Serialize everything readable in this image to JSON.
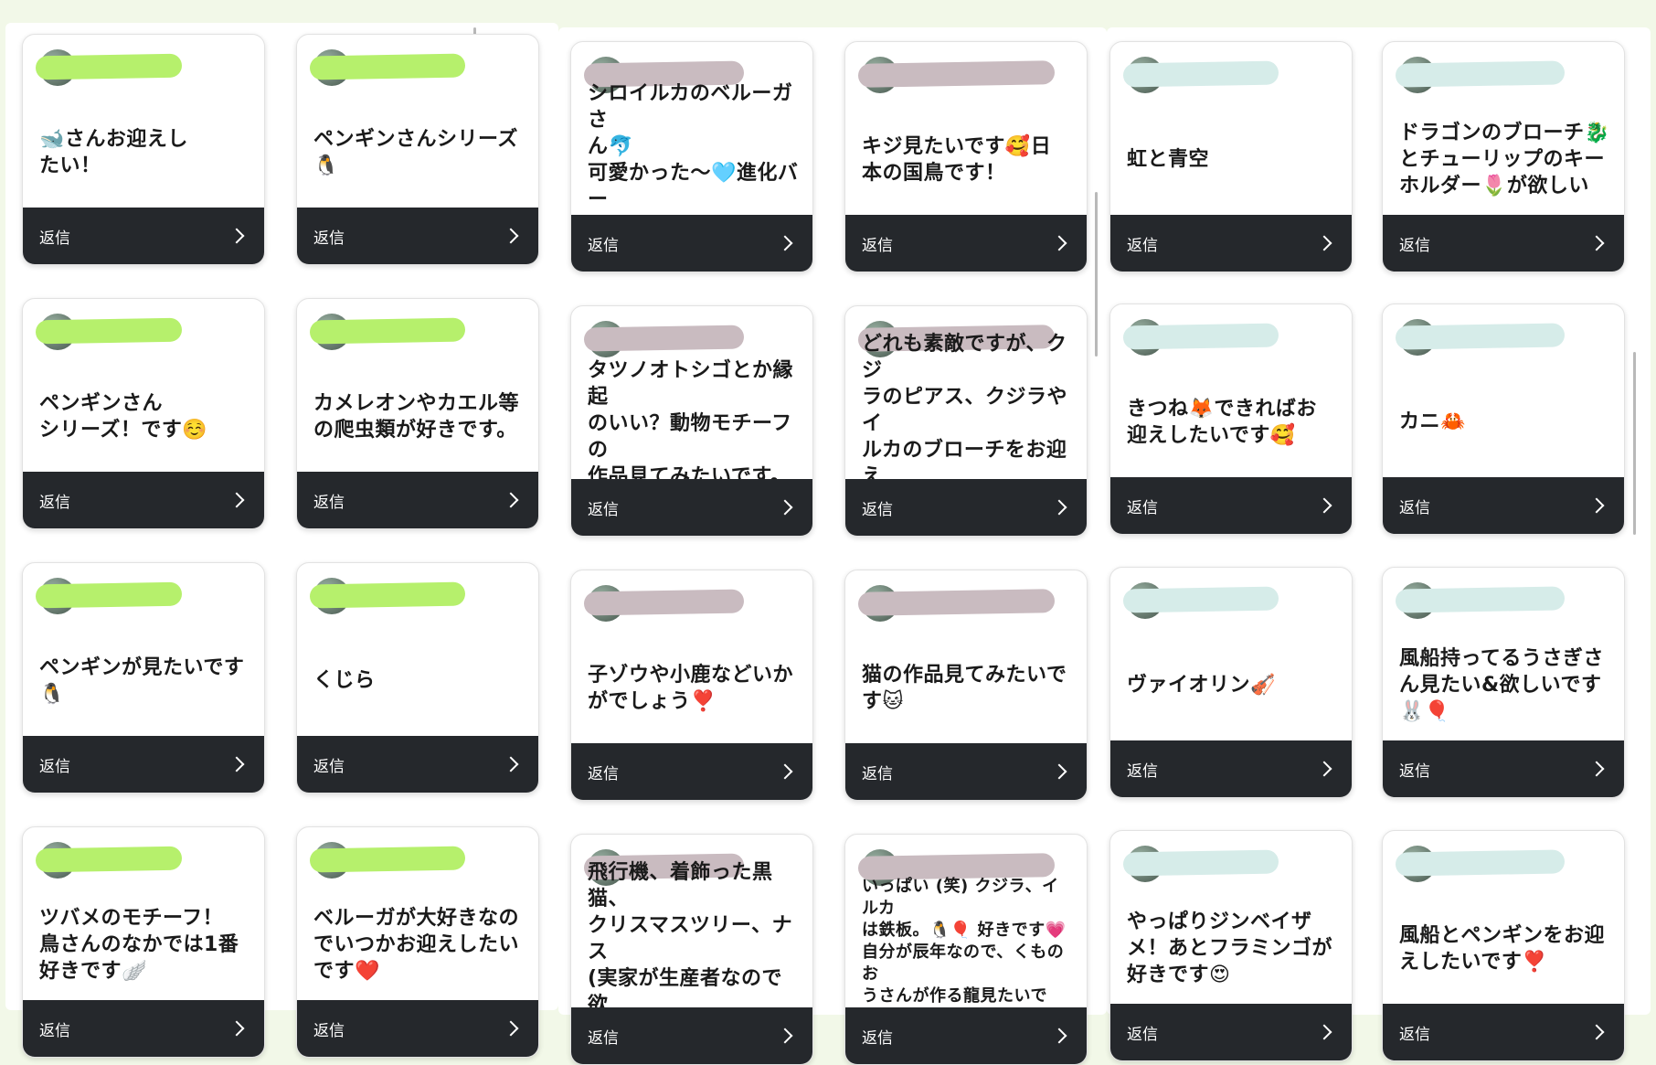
{
  "colors": {
    "reply_bar": "#25282c",
    "green_scribble": "#b6f06c",
    "mauve_scribble": "#c9bbc0",
    "aqua_scribble": "#d6ece9"
  },
  "reply_label": "返信",
  "cards": [
    {
      "message": "🐋さんお迎えし\nたい！"
    },
    {
      "message": "ペンギンさんシリーズ\n🐧"
    },
    {
      "message": "シロイルカのベルーガさ\nん🐬\n可愛かった〜🩵進化バー\nジョン見たいです！"
    },
    {
      "message": "キジ見たいです🥰日\n本の国鳥です！"
    },
    {
      "message": "虹と青空"
    },
    {
      "message": "ドラゴンのブローチ🐉\nとチューリップのキー\nホルダー🌷が欲しい"
    },
    {
      "message": "ペンギンさん\nシリーズ！です☺️"
    },
    {
      "message": "カメレオンやカエル等\nの爬虫類が好きです。"
    },
    {
      "message": "タツノオトシゴとか縁起\nのいい？動物モチーフの\n作品見てみたいです。"
    },
    {
      "message": "どれも素敵ですが、クジ\nラのピアス、クジラやイ\nルカのブローチをお迎え\nしたいです。"
    },
    {
      "message": "きつね🦊できればお\n迎えしたいです🥰"
    },
    {
      "message": "カニ🦀"
    },
    {
      "message": "ペンギンが見たいです\n🐧"
    },
    {
      "message": "くじら"
    },
    {
      "message": "子ゾウや小鹿などいか\nがでしょう❣️"
    },
    {
      "message": "猫の作品見てみたいで\nす🐱"
    },
    {
      "message": "ヴァイオリン🎻"
    },
    {
      "message": "風船持ってるうさぎさ\nん見たい&欲しいです\n🐰🎈"
    },
    {
      "message": "ツバメのモチーフ！\n鳥さんのなかでは1番\n好きです🪽"
    },
    {
      "message": "ベルーガが大好きなの\nでいつかお迎えしたい\nです❤️"
    },
    {
      "message": "飛行機、着飾った黒猫、\nクリスマスツリー、ナス\n(実家が生産者なので欲\nしい！)"
    },
    {
      "message": "いっぱい (笑) クジラ、イルカ\nは鉄板。🐧🎈 好きです💗\n自分が辰年なので、くものお\nうさんが作る龍見たいです。"
    },
    {
      "message": "やっぱりジンベイザ\nメ！あとフラミンゴが\n好きです😍"
    },
    {
      "message": "風船とペンギンをお迎\nえしたいです❣️"
    }
  ]
}
